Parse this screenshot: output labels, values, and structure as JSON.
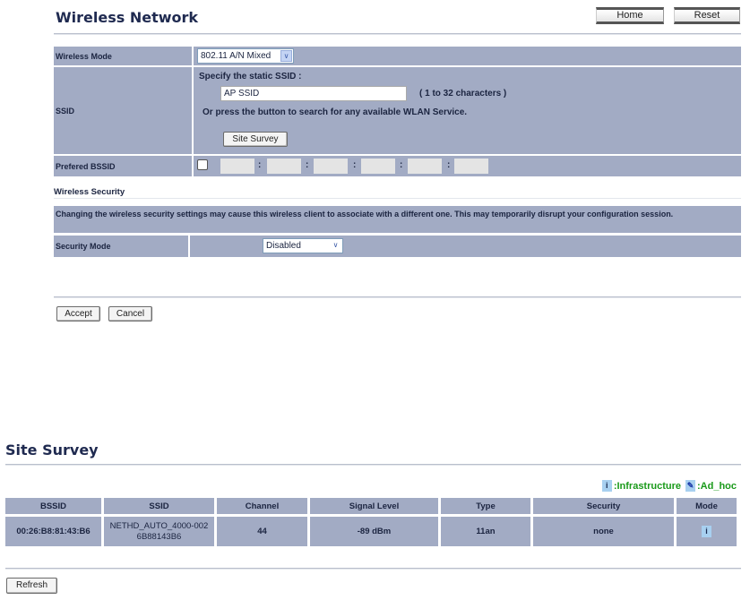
{
  "wireless_network": {
    "title": "Wireless Network",
    "home_label": "Home",
    "reset_label": "Reset",
    "wireless_mode": {
      "label": "Wireless Mode",
      "value": "802.11 A/N Mixed"
    },
    "ssid": {
      "label": "SSID",
      "specify_text": "Specify the static SSID  :",
      "value": "AP SSID",
      "hint": "( 1 to 32 characters )",
      "or_text": "Or press the button to search for any available WLAN Service.",
      "site_survey_label": "Site Survey"
    },
    "preferred_bssid": {
      "label": "Prefered BSSID",
      "separator": ":"
    },
    "security": {
      "heading": "Wireless Security",
      "notice": "Changing the wireless security settings may cause this wireless client to associate with a different one. This may temporarily disrupt your configuration session.",
      "mode_label": "Security Mode",
      "mode_value": "Disabled"
    },
    "accept_label": "Accept",
    "cancel_label": "Cancel"
  },
  "site_survey": {
    "title": "Site Survey",
    "legend": {
      "infrastructure": ":Infrastructure",
      "adhoc": ":Ad_hoc"
    },
    "columns": [
      "BSSID",
      "SSID",
      "Channel",
      "Signal Level",
      "Type",
      "Security",
      "Mode"
    ],
    "rows": [
      {
        "bssid": "00:26:B8:81:43:B6",
        "ssid": "NETHD_AUTO_4000-0026B88143B6",
        "channel": "44",
        "signal": "-89 dBm",
        "type": "11an",
        "security": "none",
        "mode": "infrastructure"
      }
    ],
    "refresh_label": "Refresh"
  },
  "colors": {
    "cell": "#a2abc4",
    "legend_text": "#1a9a1a",
    "title": "#1f2a50"
  }
}
